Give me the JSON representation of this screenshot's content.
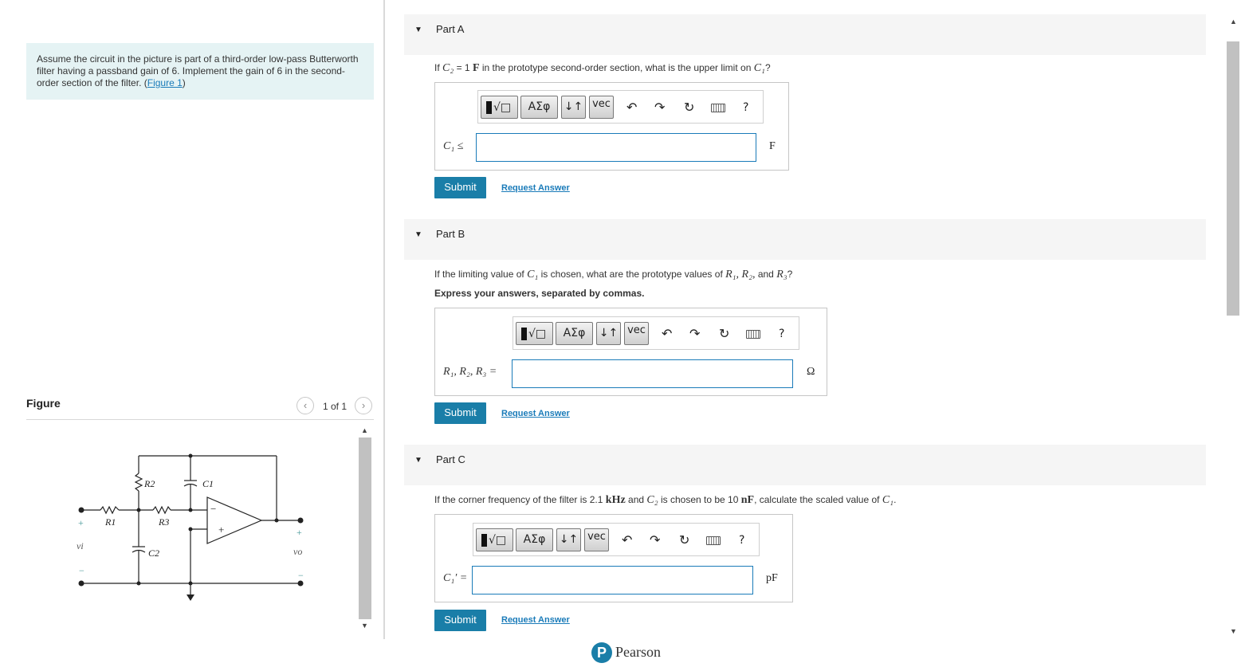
{
  "problem": {
    "text": "Assume the circuit in the picture is part of a third-order low-pass Butterworth filter having a passband gain of 6. Implement the gain of 6 in the second-order section of the filter.",
    "figure_link": "Figure 1"
  },
  "figure_panel": {
    "title": "Figure",
    "pager": "1 of 1",
    "prev_icon": "chevron-left-icon",
    "next_icon": "chevron-right-icon",
    "labels": {
      "R1": "R1",
      "R2": "R2",
      "R3": "R3",
      "C1": "C1",
      "C2": "C2",
      "vi": "vi",
      "vo": "vo",
      "plus": "+",
      "minus": "−"
    }
  },
  "toolbar": {
    "templates_icon": "templates-icon",
    "greek": "ΑΣφ",
    "arrows": "↓↑",
    "vec": "vec",
    "undo_icon": "undo-icon",
    "redo_icon": "redo-icon",
    "reset_icon": "reset-icon",
    "keyboard_icon": "keyboard-icon",
    "help": "?"
  },
  "parts": [
    {
      "title": "Part A",
      "question_pre": "If",
      "question_c2": "C₂",
      "question_mid": "= 1",
      "question_unit": "F",
      "question_post": "in the prototype second-order section, what is the upper limit on",
      "question_c1": "C₁",
      "question_end": "?",
      "answer_label": "C₁ ≤",
      "unit": "F",
      "submit": "Submit",
      "request": "Request Answer"
    },
    {
      "title": "Part B",
      "question_pre": "If the limiting value of",
      "question_c1": "C₁",
      "question_mid": "is chosen, what are the prototype values of",
      "question_vars": "R₁, R₂,",
      "question_and": "and",
      "question_r3": "R₃",
      "question_end": "?",
      "instruction": "Express your answers, separated by commas.",
      "answer_label": "R₁, R₂, R₃ =",
      "unit": "Ω",
      "submit": "Submit",
      "request": "Request Answer"
    },
    {
      "title": "Part C",
      "question_pre": "If the corner frequency of the filter is 2.1",
      "question_khz": "kHz",
      "question_and": "and",
      "question_c2": "C₂",
      "question_mid": "is chosen to be 10",
      "question_nf": "nF",
      "question_post": ", calculate the scaled value of",
      "question_c1": "C₁",
      "question_end": ".",
      "answer_label": "C₁′ =",
      "unit": "pF",
      "submit": "Submit",
      "request": "Request Answer"
    }
  ],
  "footer": {
    "brand": "Pearson",
    "logo_letter": "P"
  }
}
